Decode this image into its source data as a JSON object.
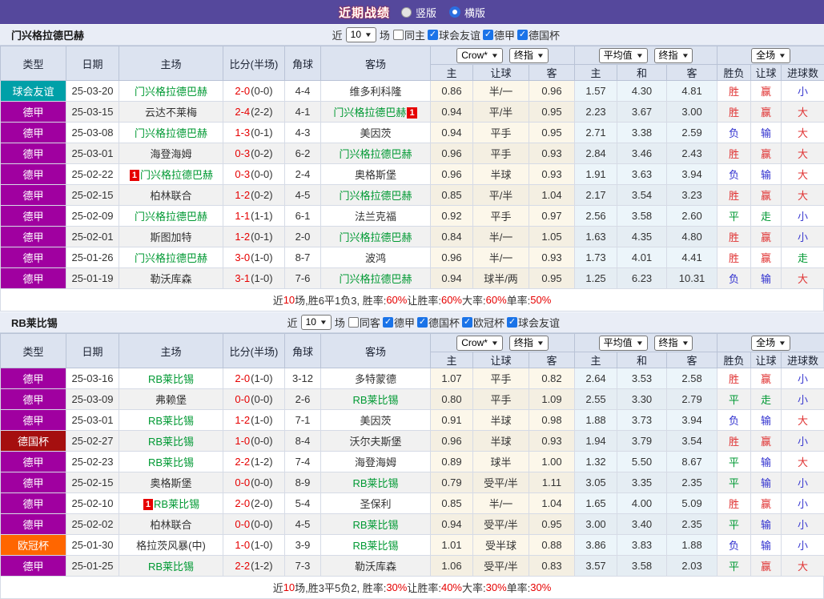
{
  "title_bar": {
    "title": "近期战绩",
    "radio_vertical": "竖版",
    "radio_horizontal": "横版",
    "selected": "横版"
  },
  "table_headers": {
    "left": [
      "类型",
      "日期",
      "主场",
      "比分(半场)",
      "角球",
      "客场"
    ],
    "select_groups": [
      [
        "Crow*",
        "终指"
      ],
      [
        "平均值",
        "终指"
      ],
      [
        "全场"
      ]
    ],
    "sub": [
      "主",
      "让球",
      "客",
      "主",
      "和",
      "客",
      "胜负",
      "让球",
      "进球数"
    ]
  },
  "type_colors": {
    "球会友谊": "#00a0a8",
    "德甲": "#a000a0",
    "德国杯": "#a50f0f",
    "欧冠杯": "#ff6600"
  },
  "result_colors": {
    "胜": "#e03333",
    "负": "#3030cf",
    "平": "#009933",
    "赢": "#e03333",
    "输": "#3030cf",
    "走": "#009933",
    "大": "#e03333",
    "小": "#3a3ad0"
  },
  "accent_colors": {
    "topbar": "#55489c",
    "checkbox": "#1a73e8",
    "score": "#e60000",
    "team_link": "#009933"
  },
  "sections": [
    {
      "team": "门兴格拉德巴赫",
      "filter": {
        "near_label": "近",
        "games": "10",
        "games_label": "场",
        "same": {
          "label": "同主",
          "checked": false
        },
        "leagues": [
          {
            "label": "球会友谊",
            "checked": true
          },
          {
            "label": "德甲",
            "checked": true
          },
          {
            "label": "德国杯",
            "checked": true
          }
        ]
      },
      "rows": [
        {
          "type": "球会友谊",
          "date": "25-03-20",
          "home": "门兴格拉德巴赫",
          "home_green": true,
          "home_badge": "",
          "score": "2-0",
          "half": "(0-0)",
          "corner": "4-4",
          "away": "维多利科隆",
          "away_green": false,
          "away_badge": "",
          "odds": [
            "0.86",
            "半/一",
            "0.96"
          ],
          "avg": [
            "1.57",
            "4.30",
            "4.81"
          ],
          "result": [
            "胜",
            "赢",
            "小"
          ]
        },
        {
          "type": "德甲",
          "date": "25-03-15",
          "home": "云达不莱梅",
          "home_green": false,
          "home_badge": "",
          "score": "2-4",
          "half": "(2-2)",
          "corner": "4-1",
          "away": "门兴格拉德巴赫",
          "away_green": true,
          "away_badge": "1",
          "odds": [
            "0.94",
            "平/半",
            "0.95"
          ],
          "avg": [
            "2.23",
            "3.67",
            "3.00"
          ],
          "result": [
            "胜",
            "赢",
            "大"
          ]
        },
        {
          "type": "德甲",
          "date": "25-03-08",
          "home": "门兴格拉德巴赫",
          "home_green": true,
          "home_badge": "",
          "score": "1-3",
          "half": "(0-1)",
          "corner": "4-3",
          "away": "美因茨",
          "away_green": false,
          "away_badge": "",
          "odds": [
            "0.94",
            "平手",
            "0.95"
          ],
          "avg": [
            "2.71",
            "3.38",
            "2.59"
          ],
          "result": [
            "负",
            "输",
            "大"
          ]
        },
        {
          "type": "德甲",
          "date": "25-03-01",
          "home": "海登海姆",
          "home_green": false,
          "home_badge": "",
          "score": "0-3",
          "half": "(0-2)",
          "corner": "6-2",
          "away": "门兴格拉德巴赫",
          "away_green": true,
          "away_badge": "",
          "odds": [
            "0.96",
            "平手",
            "0.93"
          ],
          "avg": [
            "2.84",
            "3.46",
            "2.43"
          ],
          "result": [
            "胜",
            "赢",
            "大"
          ]
        },
        {
          "type": "德甲",
          "date": "25-02-22",
          "home": "门兴格拉德巴赫",
          "home_green": true,
          "home_badge": "1",
          "score": "0-3",
          "half": "(0-0)",
          "corner": "2-4",
          "away": "奥格斯堡",
          "away_green": false,
          "away_badge": "",
          "odds": [
            "0.96",
            "半球",
            "0.93"
          ],
          "avg": [
            "1.91",
            "3.63",
            "3.94"
          ],
          "result": [
            "负",
            "输",
            "大"
          ]
        },
        {
          "type": "德甲",
          "date": "25-02-15",
          "home": "柏林联合",
          "home_green": false,
          "home_badge": "",
          "score": "1-2",
          "half": "(0-2)",
          "corner": "4-5",
          "away": "门兴格拉德巴赫",
          "away_green": true,
          "away_badge": "",
          "odds": [
            "0.85",
            "平/半",
            "1.04"
          ],
          "avg": [
            "2.17",
            "3.54",
            "3.23"
          ],
          "result": [
            "胜",
            "赢",
            "大"
          ]
        },
        {
          "type": "德甲",
          "date": "25-02-09",
          "home": "门兴格拉德巴赫",
          "home_green": true,
          "home_badge": "",
          "score": "1-1",
          "half": "(1-1)",
          "corner": "6-1",
          "away": "法兰克福",
          "away_green": false,
          "away_badge": "",
          "odds": [
            "0.92",
            "平手",
            "0.97"
          ],
          "avg": [
            "2.56",
            "3.58",
            "2.60"
          ],
          "result": [
            "平",
            "走",
            "小"
          ]
        },
        {
          "type": "德甲",
          "date": "25-02-01",
          "home": "斯图加特",
          "home_green": false,
          "home_badge": "",
          "score": "1-2",
          "half": "(0-1)",
          "corner": "2-0",
          "away": "门兴格拉德巴赫",
          "away_green": true,
          "away_badge": "",
          "odds": [
            "0.84",
            "半/一",
            "1.05"
          ],
          "avg": [
            "1.63",
            "4.35",
            "4.80"
          ],
          "result": [
            "胜",
            "赢",
            "小"
          ]
        },
        {
          "type": "德甲",
          "date": "25-01-26",
          "home": "门兴格拉德巴赫",
          "home_green": true,
          "home_badge": "",
          "score": "3-0",
          "half": "(1-0)",
          "corner": "8-7",
          "away": "波鸿",
          "away_green": false,
          "away_badge": "",
          "odds": [
            "0.96",
            "半/一",
            "0.93"
          ],
          "avg": [
            "1.73",
            "4.01",
            "4.41"
          ],
          "result": [
            "胜",
            "赢",
            "走"
          ]
        },
        {
          "type": "德甲",
          "date": "25-01-19",
          "home": "勒沃库森",
          "home_green": false,
          "home_badge": "",
          "score": "3-1",
          "half": "(1-0)",
          "corner": "7-6",
          "away": "门兴格拉德巴赫",
          "away_green": true,
          "away_badge": "",
          "odds": [
            "0.94",
            "球半/两",
            "0.95"
          ],
          "avg": [
            "1.25",
            "6.23",
            "10.31"
          ],
          "result": [
            "负",
            "输",
            "大"
          ]
        }
      ],
      "summary": [
        [
          "近",
          0
        ],
        [
          "10",
          1
        ],
        [
          "场,胜6平1负3, 胜率:",
          0
        ],
        [
          "60%",
          1
        ],
        [
          " 让胜率:",
          0
        ],
        [
          "60%",
          1
        ],
        [
          " 大率:",
          0
        ],
        [
          "60%",
          1
        ],
        [
          " 单率:",
          0
        ],
        [
          "50%",
          1
        ]
      ]
    },
    {
      "team": "RB莱比锡",
      "filter": {
        "near_label": "近",
        "games": "10",
        "games_label": "场",
        "same": {
          "label": "同客",
          "checked": false
        },
        "leagues": [
          {
            "label": "德甲",
            "checked": true
          },
          {
            "label": "德国杯",
            "checked": true
          },
          {
            "label": "欧冠杯",
            "checked": true
          },
          {
            "label": "球会友谊",
            "checked": true
          }
        ]
      },
      "rows": [
        {
          "type": "德甲",
          "date": "25-03-16",
          "home": "RB莱比锡",
          "home_green": true,
          "home_badge": "",
          "score": "2-0",
          "half": "(1-0)",
          "corner": "3-12",
          "away": "多特蒙德",
          "away_green": false,
          "away_badge": "",
          "odds": [
            "1.07",
            "平手",
            "0.82"
          ],
          "avg": [
            "2.64",
            "3.53",
            "2.58"
          ],
          "result": [
            "胜",
            "赢",
            "小"
          ]
        },
        {
          "type": "德甲",
          "date": "25-03-09",
          "home": "弗赖堡",
          "home_green": false,
          "home_badge": "",
          "score": "0-0",
          "half": "(0-0)",
          "corner": "2-6",
          "away": "RB莱比锡",
          "away_green": true,
          "away_badge": "",
          "odds": [
            "0.80",
            "平手",
            "1.09"
          ],
          "avg": [
            "2.55",
            "3.30",
            "2.79"
          ],
          "result": [
            "平",
            "走",
            "小"
          ]
        },
        {
          "type": "德甲",
          "date": "25-03-01",
          "home": "RB莱比锡",
          "home_green": true,
          "home_badge": "",
          "score": "1-2",
          "half": "(1-0)",
          "corner": "7-1",
          "away": "美因茨",
          "away_green": false,
          "away_badge": "",
          "odds": [
            "0.91",
            "半球",
            "0.98"
          ],
          "avg": [
            "1.88",
            "3.73",
            "3.94"
          ],
          "result": [
            "负",
            "输",
            "大"
          ]
        },
        {
          "type": "德国杯",
          "date": "25-02-27",
          "home": "RB莱比锡",
          "home_green": true,
          "home_badge": "",
          "score": "1-0",
          "half": "(0-0)",
          "corner": "8-4",
          "away": "沃尔夫斯堡",
          "away_green": false,
          "away_badge": "",
          "odds": [
            "0.96",
            "半球",
            "0.93"
          ],
          "avg": [
            "1.94",
            "3.79",
            "3.54"
          ],
          "result": [
            "胜",
            "赢",
            "小"
          ]
        },
        {
          "type": "德甲",
          "date": "25-02-23",
          "home": "RB莱比锡",
          "home_green": true,
          "home_badge": "",
          "score": "2-2",
          "half": "(1-2)",
          "corner": "7-4",
          "away": "海登海姆",
          "away_green": false,
          "away_badge": "",
          "odds": [
            "0.89",
            "球半",
            "1.00"
          ],
          "avg": [
            "1.32",
            "5.50",
            "8.67"
          ],
          "result": [
            "平",
            "输",
            "大"
          ]
        },
        {
          "type": "德甲",
          "date": "25-02-15",
          "home": "奥格斯堡",
          "home_green": false,
          "home_badge": "",
          "score": "0-0",
          "half": "(0-0)",
          "corner": "8-9",
          "away": "RB莱比锡",
          "away_green": true,
          "away_badge": "",
          "odds": [
            "0.79",
            "受平/半",
            "1.11"
          ],
          "avg": [
            "3.05",
            "3.35",
            "2.35"
          ],
          "result": [
            "平",
            "输",
            "小"
          ]
        },
        {
          "type": "德甲",
          "date": "25-02-10",
          "home": "RB莱比锡",
          "home_green": true,
          "home_badge": "1",
          "score": "2-0",
          "half": "(2-0)",
          "corner": "5-4",
          "away": "圣保利",
          "away_green": false,
          "away_badge": "",
          "odds": [
            "0.85",
            "半/一",
            "1.04"
          ],
          "avg": [
            "1.65",
            "4.00",
            "5.09"
          ],
          "result": [
            "胜",
            "赢",
            "小"
          ]
        },
        {
          "type": "德甲",
          "date": "25-02-02",
          "home": "柏林联合",
          "home_green": false,
          "home_badge": "",
          "score": "0-0",
          "half": "(0-0)",
          "corner": "4-5",
          "away": "RB莱比锡",
          "away_green": true,
          "away_badge": "",
          "odds": [
            "0.94",
            "受平/半",
            "0.95"
          ],
          "avg": [
            "3.00",
            "3.40",
            "2.35"
          ],
          "result": [
            "平",
            "输",
            "小"
          ]
        },
        {
          "type": "欧冠杯",
          "date": "25-01-30",
          "home": "格拉茨风暴(中)",
          "home_green": false,
          "home_badge": "",
          "score": "1-0",
          "half": "(1-0)",
          "corner": "3-9",
          "away": "RB莱比锡",
          "away_green": true,
          "away_badge": "",
          "odds": [
            "1.01",
            "受半球",
            "0.88"
          ],
          "avg": [
            "3.86",
            "3.83",
            "1.88"
          ],
          "result": [
            "负",
            "输",
            "小"
          ]
        },
        {
          "type": "德甲",
          "date": "25-01-25",
          "home": "RB莱比锡",
          "home_green": true,
          "home_badge": "",
          "score": "2-2",
          "half": "(1-2)",
          "corner": "7-3",
          "away": "勒沃库森",
          "away_green": false,
          "away_badge": "",
          "odds": [
            "1.06",
            "受平/半",
            "0.83"
          ],
          "avg": [
            "3.57",
            "3.58",
            "2.03"
          ],
          "result": [
            "平",
            "赢",
            "大"
          ]
        }
      ],
      "summary": [
        [
          "近",
          0
        ],
        [
          "10",
          1
        ],
        [
          "场,胜3平5负2, 胜率:",
          0
        ],
        [
          "30%",
          1
        ],
        [
          " 让胜率:",
          0
        ],
        [
          "40%",
          1
        ],
        [
          " 大率:",
          0
        ],
        [
          "30%",
          1
        ],
        [
          " 单率:",
          0
        ],
        [
          "30%",
          1
        ]
      ]
    }
  ]
}
